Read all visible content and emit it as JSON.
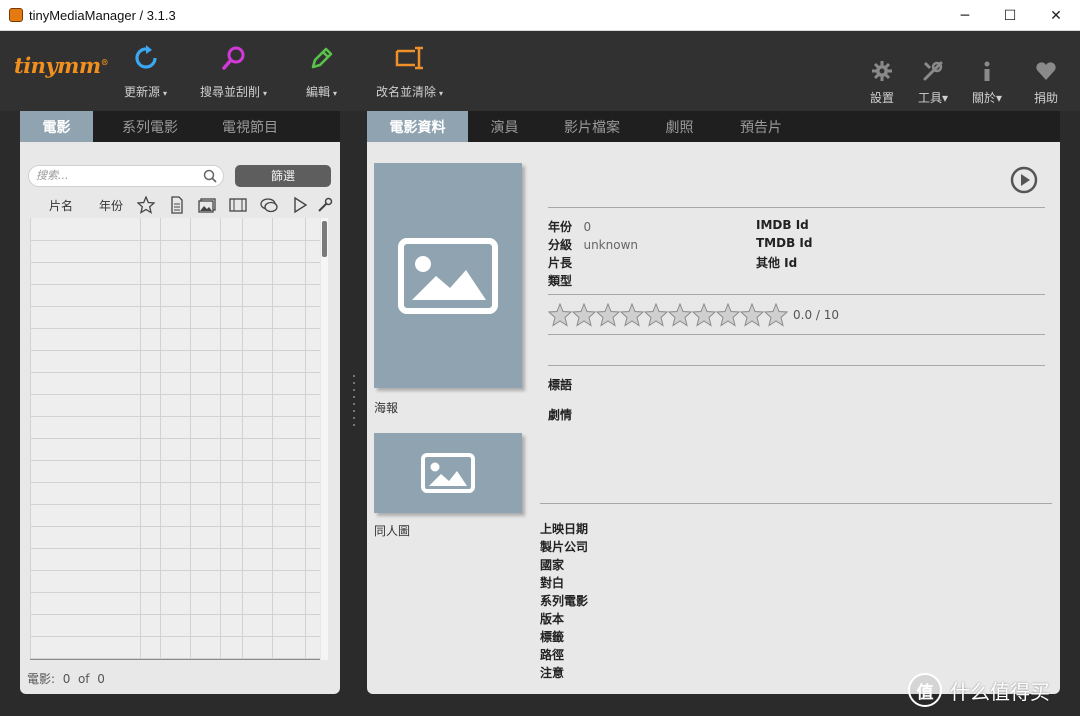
{
  "window": {
    "title": "tinyMediaManager / 3.1.3",
    "minimize_glyph": "─",
    "maximize_glyph": "☐",
    "close_glyph": "✕"
  },
  "toolbar": {
    "logo_text": "tinymm",
    "logo_mark": "®",
    "logo_color": "#f3901d",
    "tools": [
      {
        "label": "更新源",
        "icon": "refresh-icon",
        "color": "#3ba7f0"
      },
      {
        "label": "搜尋並刮削",
        "icon": "search-scrape-icon",
        "color": "#d13ad9"
      },
      {
        "label": "編輯",
        "icon": "edit-icon",
        "color": "#59c24b"
      },
      {
        "label": "改名並清除",
        "icon": "rename-icon",
        "color": "#f0902a"
      }
    ],
    "right_tools": [
      {
        "label": "設置",
        "icon": "gear-icon",
        "has_dropdown": false
      },
      {
        "label": "工具",
        "icon": "wrench-icon",
        "has_dropdown": true
      },
      {
        "label": "關於",
        "icon": "info-icon",
        "has_dropdown": true
      },
      {
        "label": "捐助",
        "icon": "heart-icon",
        "has_dropdown": false
      }
    ],
    "caret": "▾"
  },
  "left_tabs": [
    "電影",
    "系列電影",
    "電視節目"
  ],
  "right_tabs": [
    "電影資料",
    "演員",
    "影片檔案",
    "劇照",
    "預告片"
  ],
  "left_panel": {
    "search_placeholder": "搜索...",
    "filter_label": "篩選",
    "columns": {
      "title": "片名",
      "year": "年份",
      "icons": [
        "star-icon",
        "document-icon",
        "images-icon",
        "film-icon",
        "subtitle-icon",
        "play-icon",
        "wrench-icon"
      ]
    },
    "footer": {
      "label": "電影:",
      "current": "0",
      "of": "of",
      "total": "0"
    }
  },
  "details": {
    "poster_label": "海報",
    "fanart_label": "同人圖",
    "year_label": "年份",
    "year_value": "0",
    "cert_label": "分級",
    "cert_value": "unknown",
    "runtime_label": "片長",
    "genre_label": "類型",
    "imdb_label": "IMDB Id",
    "tmdb_label": "TMDB Id",
    "other_id_label": "其他 Id",
    "rating": {
      "value": 0.0,
      "max": 10,
      "text": "0.0 / 10",
      "stars": 10
    },
    "tagline_label": "標語",
    "plot_label": "劇情",
    "meta_labels": [
      "上映日期",
      "製片公司",
      "國家",
      "對白",
      "系列電影",
      "版本",
      "標籤",
      "路徑",
      "注意"
    ]
  },
  "colors": {
    "accent": "#8fa3b1",
    "toolbar_bg": "#313131",
    "panel_bg": "#e8e8e8"
  },
  "watermark": {
    "logo": "值",
    "text": "什么值得买"
  }
}
